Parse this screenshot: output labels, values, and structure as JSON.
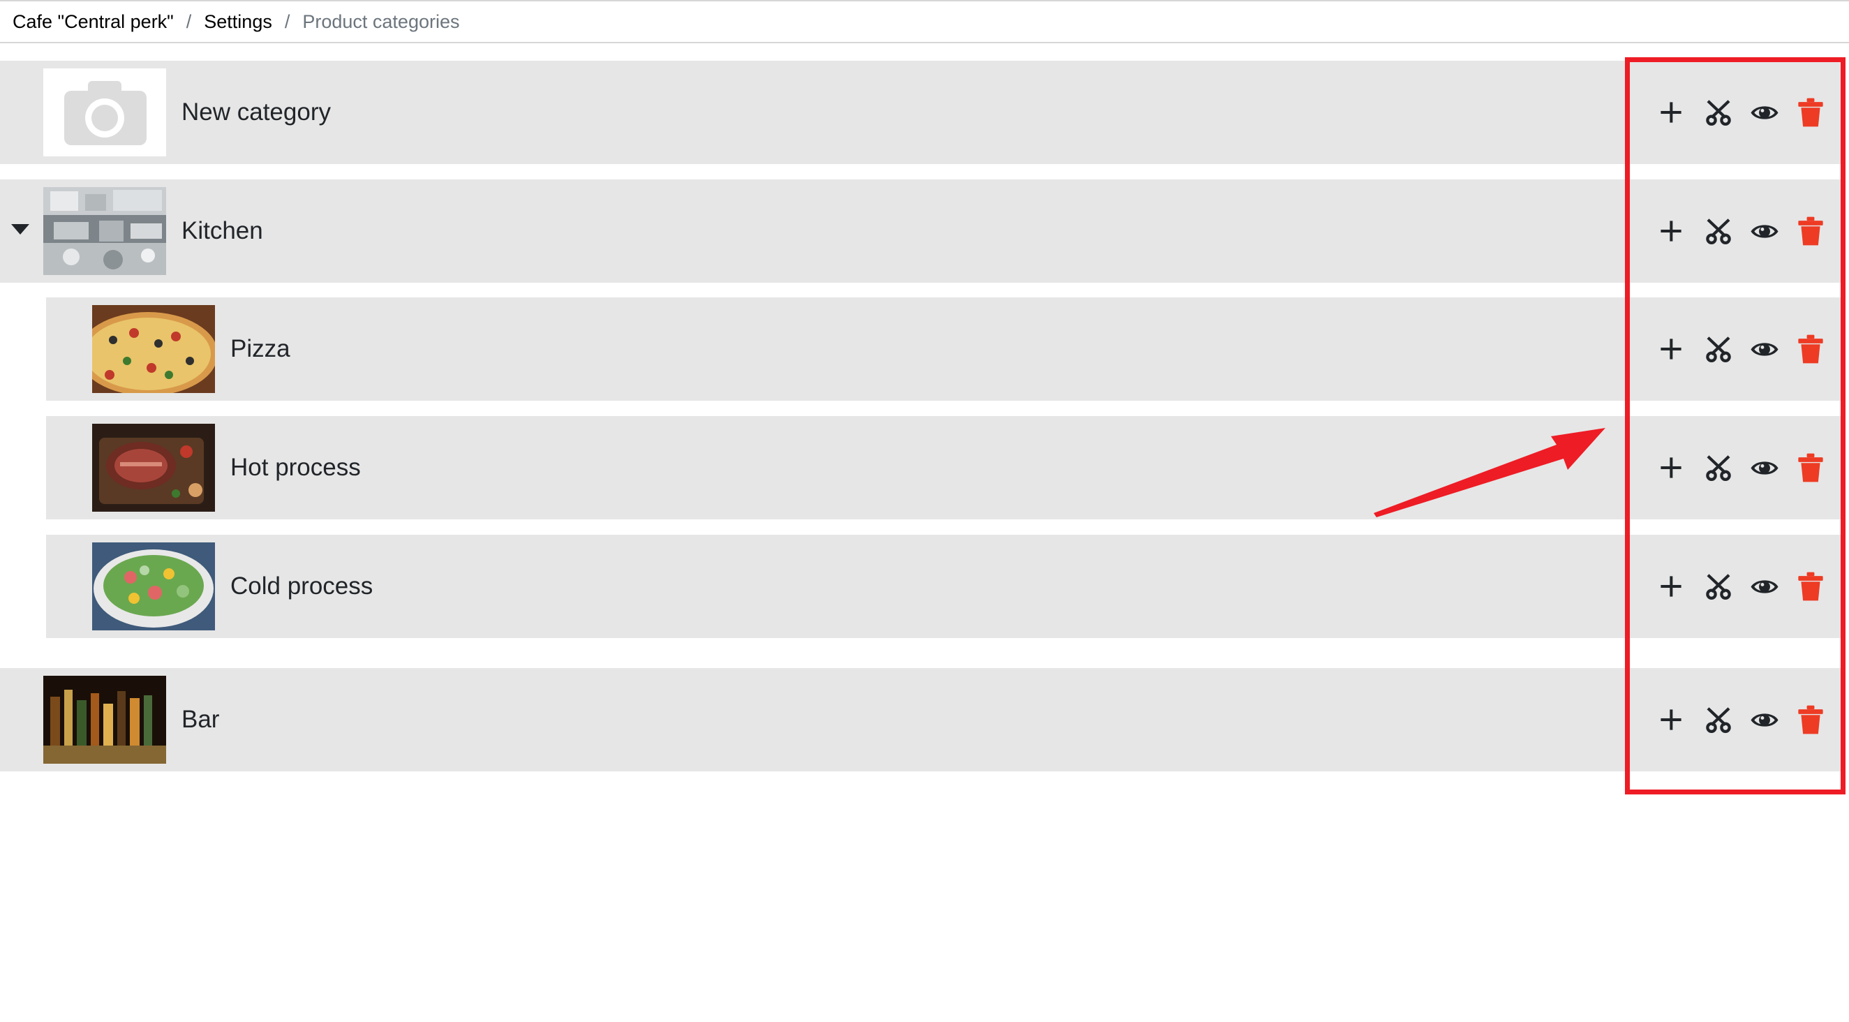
{
  "breadcrumb": {
    "items": [
      {
        "label": "Cafe \"Central perk\""
      },
      {
        "label": "Settings"
      },
      {
        "label": "Product categories"
      }
    ],
    "separator": "/"
  },
  "categories": [
    {
      "label": "New category",
      "level": 0,
      "image": "camera-placeholder",
      "expanded": null
    },
    {
      "label": "Kitchen",
      "level": 0,
      "image": "kitchen-photo",
      "expanded": true
    },
    {
      "label": "Pizza",
      "level": 1,
      "image": "pizza-photo"
    },
    {
      "label": "Hot process",
      "level": 1,
      "image": "steak-photo"
    },
    {
      "label": "Cold process",
      "level": 1,
      "image": "salad-photo"
    },
    {
      "label": "Bar",
      "level": 0,
      "image": "bar-photo",
      "expanded": null
    }
  ],
  "row_actions": [
    "add-icon",
    "cut-icon",
    "view-icon",
    "delete-icon"
  ],
  "colors": {
    "row_background": "#e6e6e6",
    "icon": "#212529",
    "delete": "#ee3b24",
    "annotation": "#ee1c25",
    "breadcrumb_active": "#6c757d"
  }
}
